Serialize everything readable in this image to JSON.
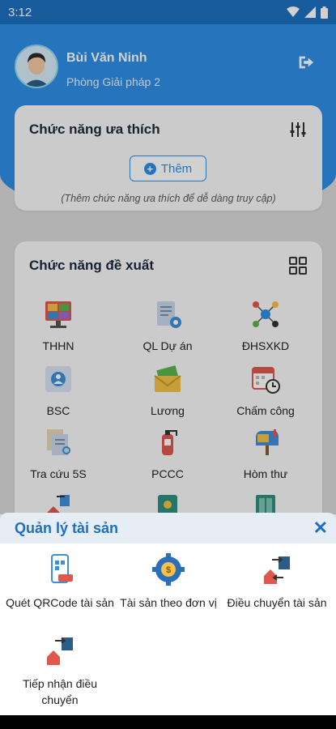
{
  "status_bar": {
    "time": "3:12"
  },
  "profile": {
    "name": "Bùi Văn Ninh",
    "department": "Phòng Giải pháp 2"
  },
  "favorites": {
    "title": "Chức năng ưa thích",
    "add_label": "Thêm",
    "hint": "(Thêm chức năng ưa thích để dễ dàng truy cập)"
  },
  "suggested": {
    "title": "Chức năng đề xuất",
    "items": [
      {
        "label": "THHN",
        "icon": "meeting-icon"
      },
      {
        "label": "QL Dự án",
        "icon": "project-icon"
      },
      {
        "label": "ĐHSXKD",
        "icon": "network-icon"
      },
      {
        "label": "BSC",
        "icon": "bsc-icon"
      },
      {
        "label": "Lương",
        "icon": "money-envelope-icon"
      },
      {
        "label": "Chấm công",
        "icon": "calendar-clock-icon"
      },
      {
        "label": "Tra cứu 5S",
        "icon": "document-search-icon"
      },
      {
        "label": "PCCC",
        "icon": "fire-extinguisher-icon"
      },
      {
        "label": "Hòm thư",
        "icon": "mailbox-icon"
      }
    ]
  },
  "asset_sheet": {
    "title": "Quản lý tài sản",
    "items": [
      {
        "label": "Quét QRCode tài sản",
        "icon": "qr-phone-icon"
      },
      {
        "label": "Tài sản theo đơn vị",
        "icon": "gear-coin-icon"
      },
      {
        "label": "Điều chuyển tài sản",
        "icon": "transfer-house-icon"
      },
      {
        "label": "Tiếp nhận điều chuyển",
        "icon": "receive-transfer-icon"
      }
    ]
  },
  "colors": {
    "primary": "#2e8ee6",
    "header_dark": "#1e6fbf"
  }
}
